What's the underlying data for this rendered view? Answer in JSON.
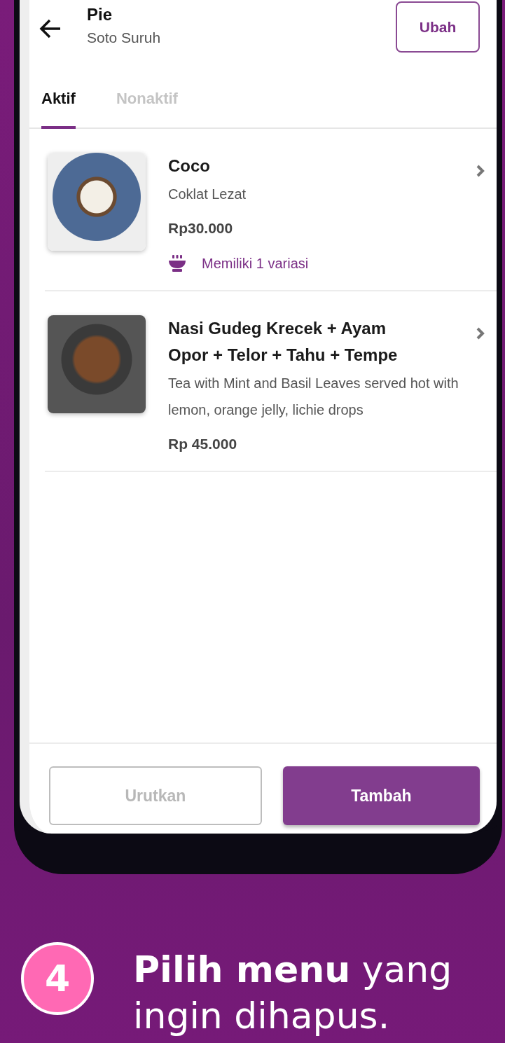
{
  "header": {
    "title": "Pie",
    "subtitle": "Soto Suruh",
    "edit_button": "Ubah"
  },
  "tabs": [
    {
      "label": "Aktif",
      "selected": true
    },
    {
      "label": "Nonaktif",
      "selected": false
    }
  ],
  "menu_items": [
    {
      "name": "Coco",
      "description": "Coklat Lezat",
      "price": "Rp30.000",
      "variant_note": "Memiliki 1 variasi"
    },
    {
      "name": "Nasi Gudeg Krecek + Ayam Opor + Telor + Tahu + Tempe",
      "description": "Tea with Mint and Basil Leaves served hot with lemon, orange jelly, lichie drops",
      "price": "Rp 45.000"
    }
  ],
  "footer_buttons": [
    {
      "label": "Urutkan",
      "kind": "outline"
    },
    {
      "label": "Tambah",
      "kind": "primary"
    }
  ],
  "step": {
    "number": "4",
    "caption": "**Pilih menu** yang ingin dihapus."
  }
}
